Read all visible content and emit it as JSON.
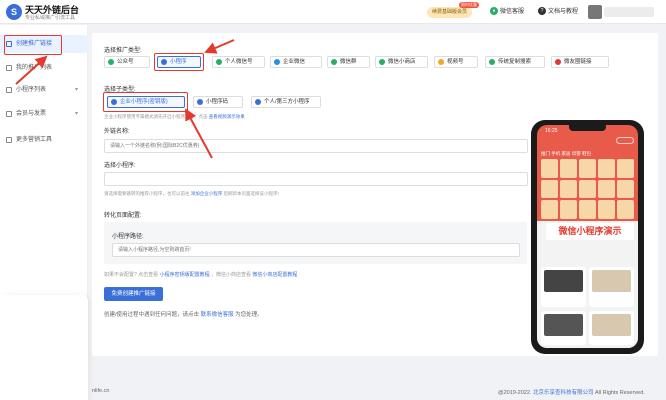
{
  "header": {
    "logo_glyph": "S",
    "brand_title": "天天外链后台",
    "brand_subtitle": "专业私域推广引流工具",
    "promo_label": "续费基础版会员",
    "promo_tag": "限时优惠",
    "links": [
      {
        "label": "微信客服",
        "icon": "wechat-icon",
        "color": "#2aae67"
      },
      {
        "label": "文档与教程",
        "icon": "help-icon",
        "color": "#333333"
      }
    ]
  },
  "sidebar": {
    "items": [
      {
        "label": "创建推广链接",
        "icon": "link-icon",
        "active": true
      },
      {
        "label": "我的推广列表",
        "icon": "list-icon"
      },
      {
        "label": "小程序列表",
        "icon": "miniprogram-icon",
        "chevron": "▾"
      },
      {
        "label": "会员与发票",
        "icon": "member-icon",
        "chevron": "▾"
      },
      {
        "label": "更多营销工具",
        "icon": "grid-icon"
      }
    ]
  },
  "form": {
    "promo_type_label": "选择推广类型:",
    "promo_types": [
      {
        "label": "公众号",
        "color": "#2aae67"
      },
      {
        "label": "小程序",
        "color": "#3a6fd8",
        "selected": true
      },
      {
        "label": "个人微信号",
        "color": "#2aae67"
      },
      {
        "label": "企业微信",
        "color": "#2a8ee5"
      },
      {
        "label": "微信群",
        "color": "#2aae67"
      },
      {
        "label": "微信小商店",
        "color": "#2aae67"
      },
      {
        "label": "视频号",
        "color": "#f5a623"
      },
      {
        "label": "传统复制搜索",
        "color": "#2aae67"
      },
      {
        "label": "微友圈链接",
        "color": "#e23a2e"
      }
    ],
    "subtype_label": "选择子类型:",
    "subtypes": [
      {
        "label": "企业小程序(密钥版)",
        "selected": true
      },
      {
        "label": "小程序码"
      },
      {
        "label": "个人/第三方小程序"
      }
    ],
    "subtype_hint": "企业小程序使用专属模式请先开启小程序后台，点击",
    "subtype_hint_link": "查看视频演示效果",
    "name_label": "外链名称:",
    "name_placeholder": "请输入一个外链名称(例:国际B2C优惠券)",
    "mp_label": "选择小程序:",
    "mp_hint": "请选择需要跳转的推荐小程序，也可以前往",
    "mp_hint_link": "添加企业小程序",
    "mp_hint_tail": "后刷新本页面选择该小程序!",
    "page_section_label": "转化页面配置:",
    "path_label": "小程序路径:",
    "path_placeholder": "请输入小程序路径,为空则跳首页!",
    "config_hint_prefix": "如果不会配置? 点击查看",
    "config_hint_link1": "小程序密钥版配置教程",
    "config_hint_mid": "，微信小商店查看",
    "config_hint_link2": "微信小商店配置教程",
    "submit_label": "免费创建推广链接",
    "help_text_prefix": "创建/使用过程中遇到任何问题，请点击",
    "help_link": "联系微信客服",
    "help_text_suffix": "为您处理。"
  },
  "phone": {
    "time": "16:25",
    "tabs": "推门  手机  家居  母婴  鞋包",
    "demo_label": "微信小程序演示"
  },
  "footer": {
    "domain": "nlife.cn",
    "copyright_prefix": "@2019-2022.",
    "company": "北京乐享查科技有限公司",
    "rights": "All Rights Reserved."
  },
  "colors": {
    "accent": "#3a6fd8",
    "highlight": "#e23a2e"
  }
}
